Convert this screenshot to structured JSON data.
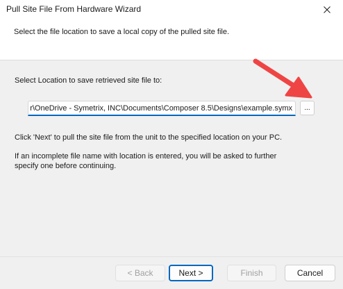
{
  "window": {
    "title": "Pull Site File From Hardware Wizard"
  },
  "header": {
    "instruction": "Select the file location to save a local copy of the pulled site file."
  },
  "main": {
    "location_label": "Select Location to save retrieved site file to:",
    "path_value": "C:\\Users\\user\\OneDrive - Symetrix, INC\\Documents\\Composer 8.5\\Designs\\example.symx",
    "browse_label": "...",
    "info_line1": "Click 'Next' to pull the site file from the unit to the specified location on your PC.",
    "info_line2a": "If an incomplete file name with location is entered, you will be asked to further",
    "info_line2b": "specify one before continuing."
  },
  "footer": {
    "back_label": "< Back",
    "next_label": "Next >",
    "finish_label": "Finish",
    "cancel_label": "Cancel"
  },
  "colors": {
    "accent": "#0067c0",
    "annotation_arrow": "#ef4444"
  }
}
